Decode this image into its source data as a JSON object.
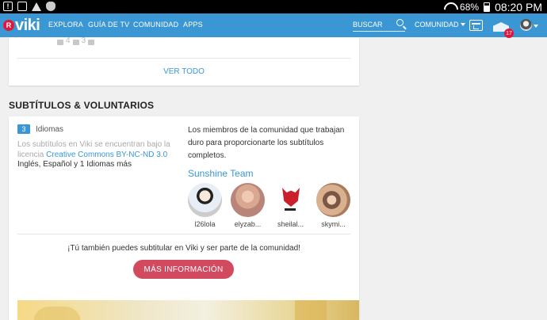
{
  "status_bar": {
    "battery": "68%",
    "time": "08:20 PM"
  },
  "nav": {
    "logo": "viki",
    "logo_mark": "R",
    "links": [
      "EXPLORA",
      "GUÍA DE TV",
      "COMUNIDAD",
      "APPS"
    ],
    "search_placeholder": "BUSCAR",
    "community_dropdown": "COMUNIDAD",
    "notification_count": "17"
  },
  "top_card": {
    "counts": [
      "4",
      "3"
    ],
    "see_all": "VER TODO"
  },
  "section": {
    "title": "SUBTÍTULOS & VOLUNTARIOS"
  },
  "subtitles": {
    "language_count": "3",
    "language_label": "Idiomas",
    "license_prefix": "Los subtítulos en Viki se encuentran bajo la licencia",
    "license_link": "Creative Commons BY-NC-ND 3.0",
    "languages": "Inglés, Español y 1 Idiomas más",
    "community_text": "Los miembros de la comunidad que trabajan duro para proporcionarte los subtítulos completos.",
    "team_name": "Sunshine Team",
    "members": [
      {
        "name": "l26lola"
      },
      {
        "name": "elyzab..."
      },
      {
        "name": "sheilal..."
      },
      {
        "name": "skymi..."
      }
    ],
    "cta_text": "¡Tú también puedes subtitular en Viki y ser parte de la comunidad!",
    "cta_button": "MÁS INFORMACIÓN"
  },
  "colors": {
    "brand_blue": "#3a97d4",
    "logo_red": "#e0173b",
    "cta_pink": "#d24a60"
  },
  "icons": [
    "alert-icon",
    "camera-icon",
    "user-alert-icon",
    "shield-icon",
    "wifi-icon",
    "battery-icon",
    "search-icon",
    "calendar-icon",
    "mail-icon",
    "avatar",
    "like-icon",
    "comment-icon",
    "flag-icon"
  ]
}
